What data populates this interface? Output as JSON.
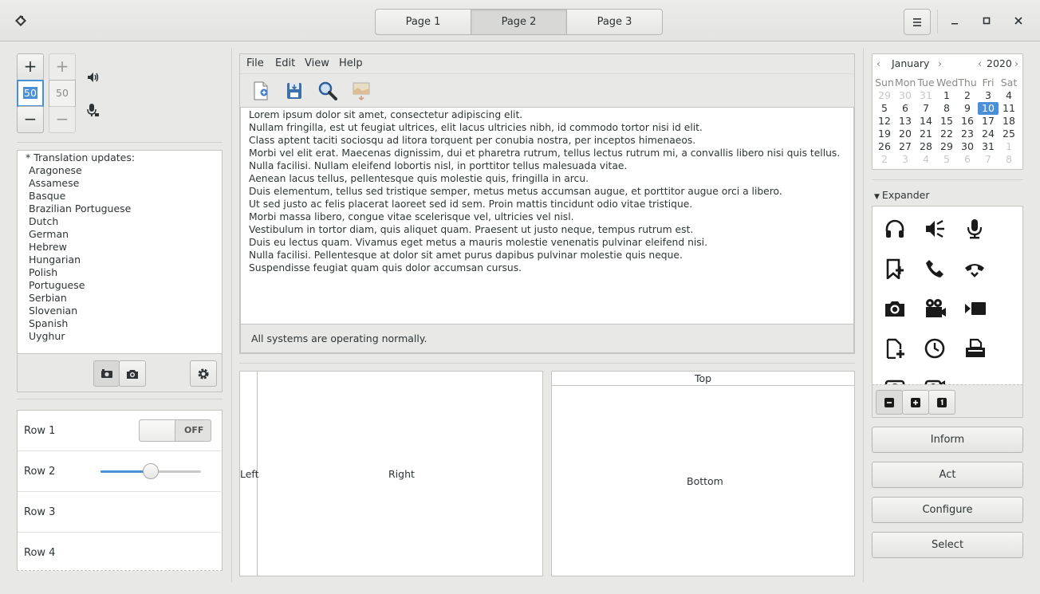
{
  "header": {
    "app_icon": "app-diamond-icon",
    "tabs": [
      "Page 1",
      "Page 2",
      "Page 3"
    ],
    "active_tab": "Page 2",
    "menu_icon": "hamburger-icon",
    "window_controls": {
      "minimize": "–",
      "maximize": "□",
      "close": "✕"
    }
  },
  "spinners": {
    "plus": "+",
    "minus": "−",
    "value1": "50",
    "value2": "50"
  },
  "translation_list": {
    "heading": "* Translation updates:",
    "items": [
      "Aragonese",
      "Assamese",
      "Basque",
      "Brazilian Portuguese",
      "Dutch",
      "German",
      "Hebrew",
      "Hungarian",
      "Polish",
      "Portuguese",
      "Serbian",
      "Slovenian",
      "Spanish",
      "Uyghur"
    ]
  },
  "rows": {
    "row1": "Row 1",
    "row1_switch": "OFF",
    "row2": "Row 2",
    "row2_slider_value": 0.5,
    "row3": "Row 3",
    "row4": "Row 4"
  },
  "menubar": [
    "File",
    "Edit",
    "View",
    "Help"
  ],
  "text_lines": [
    "Lorem ipsum dolor sit amet, consectetur adipiscing elit.",
    "Nullam fringilla, est ut feugiat ultrices, elit lacus ultricies nibh, id commodo tortor nisi id elit.",
    "Class aptent taciti sociosqu ad litora torquent per conubia nostra, per inceptos himenaeos.",
    "Morbi vel elit erat. Maecenas dignissim, dui et pharetra rutrum, tellus lectus rutrum mi, a convallis libero nisi quis tellus.",
    "Nulla facilisi. Nullam eleifend lobortis nisl, in porttitor tellus malesuada vitae.",
    "Aenean lacus tellus, pellentesque quis molestie quis, fringilla in arcu.",
    "Duis elementum, tellus sed tristique semper, metus metus accumsan augue, et porttitor augue orci a libero.",
    "Ut sed justo ac felis placerat laoreet sed id sem. Proin mattis tincidunt odio vitae tristique.",
    "Morbi massa libero, congue vitae scelerisque vel, ultricies vel nisl.",
    "Vestibulum in tortor diam, quis aliquet quam. Praesent ut justo neque, tempus rutrum est.",
    "Duis eu lectus quam. Vivamus eget metus a mauris molestie venenatis pulvinar eleifend nisi.",
    "Nulla facilisi. Pellentesque at dolor sit amet purus dapibus pulvinar molestie quis neque.",
    "Suspendisse feugiat quam quis dolor accumsan cursus."
  ],
  "status": "All systems are operating normally.",
  "panes": {
    "left": "Left",
    "right": "Right",
    "top": "Top",
    "bottom": "Bottom"
  },
  "calendar": {
    "month": "January",
    "year": "2020",
    "weekdays": [
      "Sun",
      "Mon",
      "Tue",
      "Wed",
      "Thu",
      "Fri",
      "Sat"
    ],
    "weeks": [
      [
        [
          "29",
          1
        ],
        [
          "30",
          1
        ],
        [
          "31",
          1
        ],
        [
          "1",
          0
        ],
        [
          "2",
          0
        ],
        [
          "3",
          0
        ],
        [
          "4",
          0
        ]
      ],
      [
        [
          "5",
          0
        ],
        [
          "6",
          0
        ],
        [
          "7",
          0
        ],
        [
          "8",
          0
        ],
        [
          "9",
          0
        ],
        [
          "10",
          2
        ],
        [
          "11",
          0
        ]
      ],
      [
        [
          "12",
          0
        ],
        [
          "13",
          0
        ],
        [
          "14",
          0
        ],
        [
          "15",
          0
        ],
        [
          "16",
          0
        ],
        [
          "17",
          0
        ],
        [
          "18",
          0
        ]
      ],
      [
        [
          "19",
          0
        ],
        [
          "20",
          0
        ],
        [
          "21",
          0
        ],
        [
          "22",
          0
        ],
        [
          "23",
          0
        ],
        [
          "24",
          0
        ],
        [
          "25",
          0
        ]
      ],
      [
        [
          "26",
          0
        ],
        [
          "27",
          0
        ],
        [
          "28",
          0
        ],
        [
          "29",
          0
        ],
        [
          "30",
          0
        ],
        [
          "31",
          0
        ],
        [
          "1",
          1
        ]
      ],
      [
        [
          "2",
          1
        ],
        [
          "3",
          1
        ],
        [
          "4",
          1
        ],
        [
          "5",
          1
        ],
        [
          "6",
          1
        ],
        [
          "7",
          1
        ],
        [
          "8",
          1
        ]
      ]
    ]
  },
  "expander": {
    "label": "Expander"
  },
  "actions": {
    "inform": "Inform",
    "act": "Act",
    "configure": "Configure",
    "select": "Select"
  },
  "colors": {
    "accent": "#4a90d9",
    "window_bg": "#e8e8e7"
  }
}
